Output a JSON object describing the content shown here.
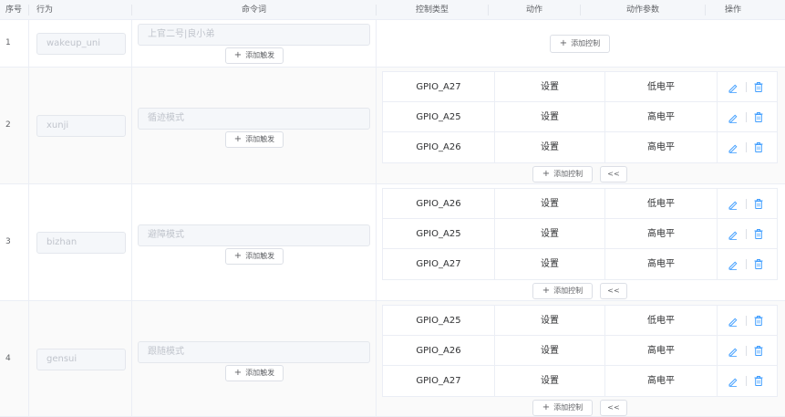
{
  "columns": {
    "index": "序号",
    "behavior": "行为",
    "command": "命令词",
    "control_type": "控制类型",
    "action": "动作",
    "action_param": "动作参数",
    "operation": "操作"
  },
  "add_trigger_label": "添加触发",
  "add_control_label": "添加控制",
  "collapse_label": "<<",
  "icons": {
    "edit": "edit-pen-icon",
    "delete": "trash-icon",
    "accent": "#409eff"
  },
  "rows": [
    {
      "index": "1",
      "behavior": "wakeup_uni",
      "command": "上官二号|良小弟",
      "controls": []
    },
    {
      "index": "2",
      "behavior": "xunji",
      "command": "循迹模式",
      "controls": [
        {
          "type": "GPIO_A27",
          "action": "设置",
          "param": "低电平"
        },
        {
          "type": "GPIO_A25",
          "action": "设置",
          "param": "高电平"
        },
        {
          "type": "GPIO_A26",
          "action": "设置",
          "param": "高电平"
        }
      ]
    },
    {
      "index": "3",
      "behavior": "bizhan",
      "command": "避障模式",
      "controls": [
        {
          "type": "GPIO_A26",
          "action": "设置",
          "param": "低电平"
        },
        {
          "type": "GPIO_A25",
          "action": "设置",
          "param": "高电平"
        },
        {
          "type": "GPIO_A27",
          "action": "设置",
          "param": "高电平"
        }
      ]
    },
    {
      "index": "4",
      "behavior": "gensui",
      "command": "跟随模式",
      "controls": [
        {
          "type": "GPIO_A25",
          "action": "设置",
          "param": "低电平"
        },
        {
          "type": "GPIO_A26",
          "action": "设置",
          "param": "高电平"
        },
        {
          "type": "GPIO_A27",
          "action": "设置",
          "param": "高电平"
        }
      ]
    }
  ]
}
